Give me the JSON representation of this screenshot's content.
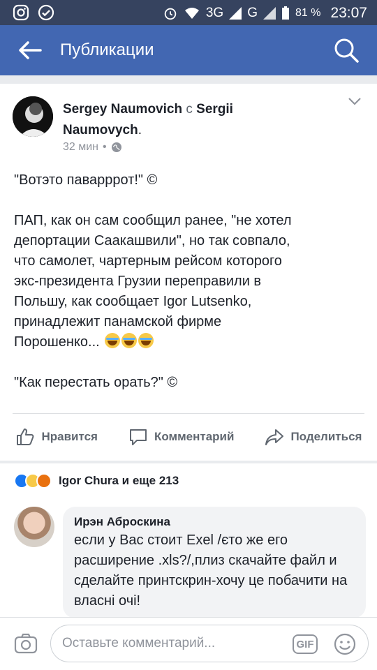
{
  "statusbar": {
    "battery": "81 %",
    "time": "23:07",
    "network1": "3G",
    "network2": "G"
  },
  "appbar": {
    "title": "Публикации"
  },
  "post": {
    "author": "Sergey Naumovich",
    "with_word": "с",
    "tagged_line1": "Sergii",
    "tagged_line2": "Naumovych",
    "time": "32 мин",
    "lines": [
      "\"Вотэто паварррот!\" ©",
      "",
      "ПАП, как он сам сообщил ранее, \"не хотел",
      "депортации Саакашвили\", но так совпало,",
      "что самолет, чартерным рейсом которого",
      "экс-президента Грузии переправили в",
      "Польшу, как сообщает Igor Lutsenko,",
      "принадлежит панамской фирме",
      "Порошенко...",
      "",
      "\"Как перестать орать?\" ©"
    ],
    "actions": {
      "like": "Нравится",
      "comment": "Комментарий",
      "share": "Поделиться"
    }
  },
  "reactions": {
    "text": "Igor Chura и еще 213"
  },
  "comment": {
    "author": "Ирэн Аброскина",
    "text": "если у Вас стоит Exel /єто же его расширение .xls?/,плиз скачайте файл и сделайте принтскрин-хочу це побачити на власні очі!"
  },
  "composer": {
    "placeholder": "Оставьте комментарий...",
    "gif_label": "GIF"
  }
}
